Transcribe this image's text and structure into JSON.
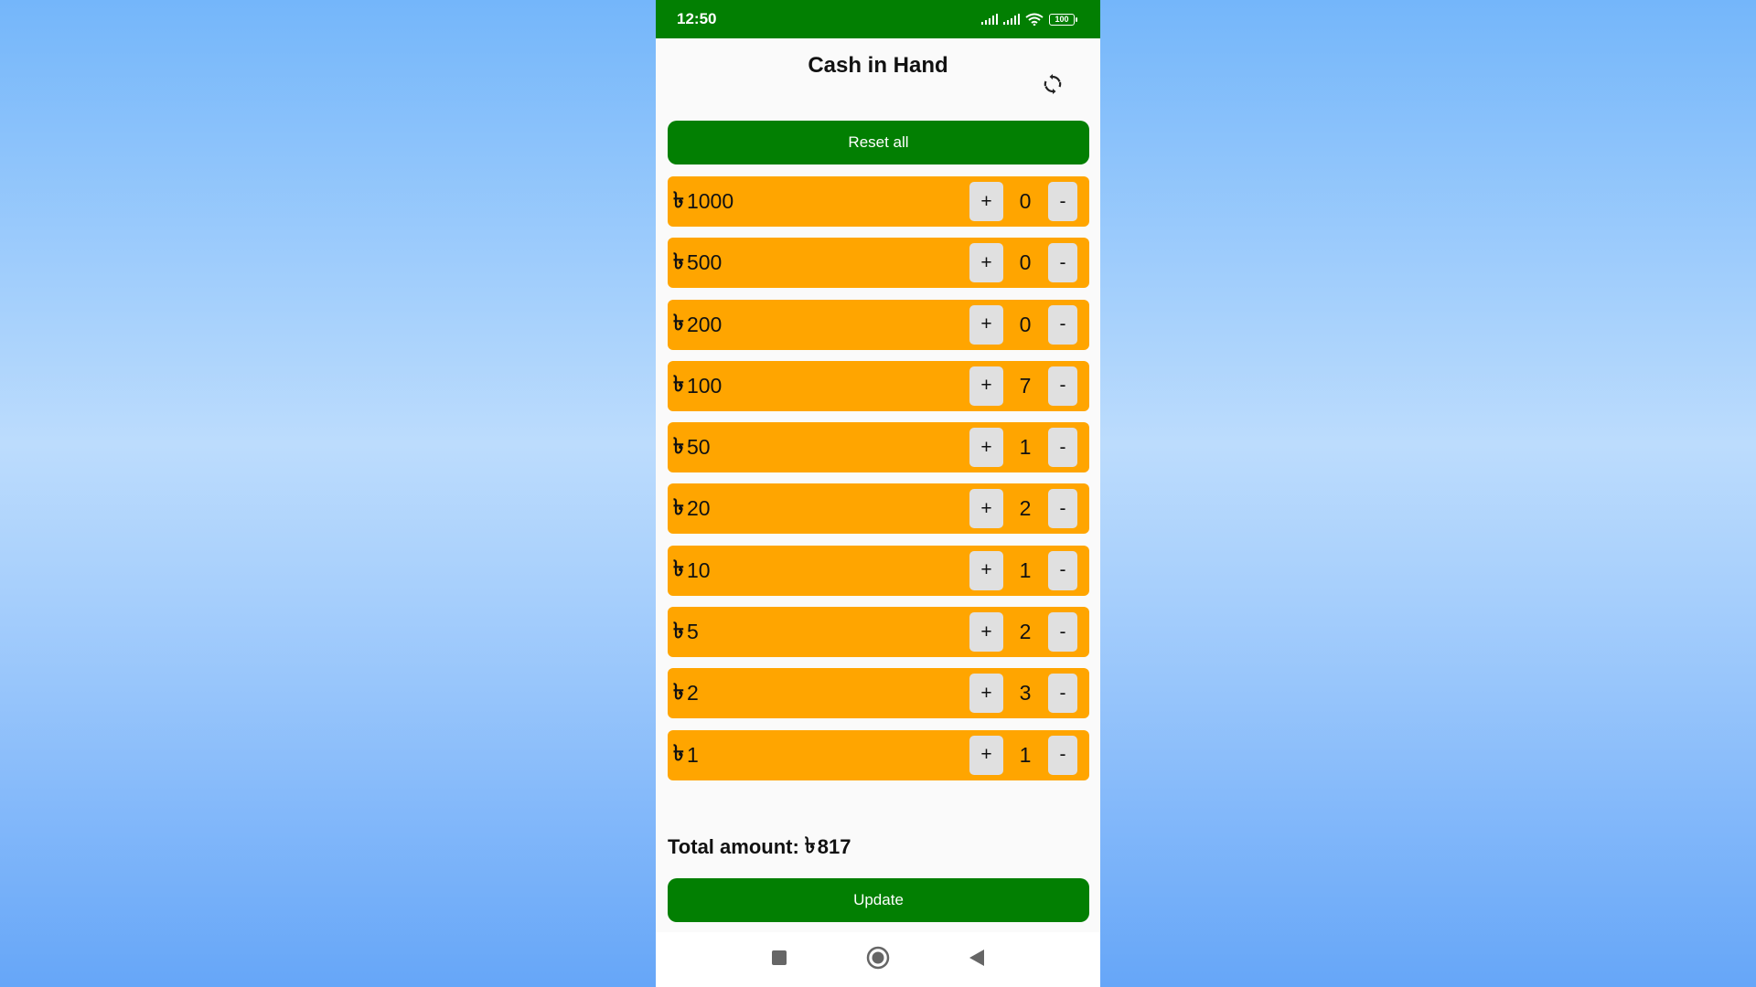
{
  "status_bar": {
    "time": "12:50",
    "battery": "100",
    "icons": [
      "signal-icon",
      "signal-icon",
      "wifi-icon",
      "battery-icon"
    ]
  },
  "header": {
    "title": "Cash in Hand",
    "refresh_icon": "refresh-icon"
  },
  "reset_label": "Reset all",
  "currency_symbol": "৳",
  "denominations": [
    {
      "value": "1000",
      "count": "0"
    },
    {
      "value": "500",
      "count": "0"
    },
    {
      "value": "200",
      "count": "0"
    },
    {
      "value": "100",
      "count": "7"
    },
    {
      "value": "50",
      "count": "1"
    },
    {
      "value": "20",
      "count": "2"
    },
    {
      "value": "10",
      "count": "1"
    },
    {
      "value": "5",
      "count": "2"
    },
    {
      "value": "2",
      "count": "3"
    },
    {
      "value": "1",
      "count": "1"
    }
  ],
  "stepper": {
    "plus_label": "+",
    "minus_label": "-"
  },
  "total": {
    "label": "Total amount:",
    "amount": "817"
  },
  "update_label": "Update",
  "nav_bar": [
    "recents-icon",
    "home-icon",
    "back-icon"
  ],
  "colors": {
    "primary_green": "#027f02",
    "row_orange": "#ffa500",
    "stepper_gray": "#e0e0e0"
  }
}
